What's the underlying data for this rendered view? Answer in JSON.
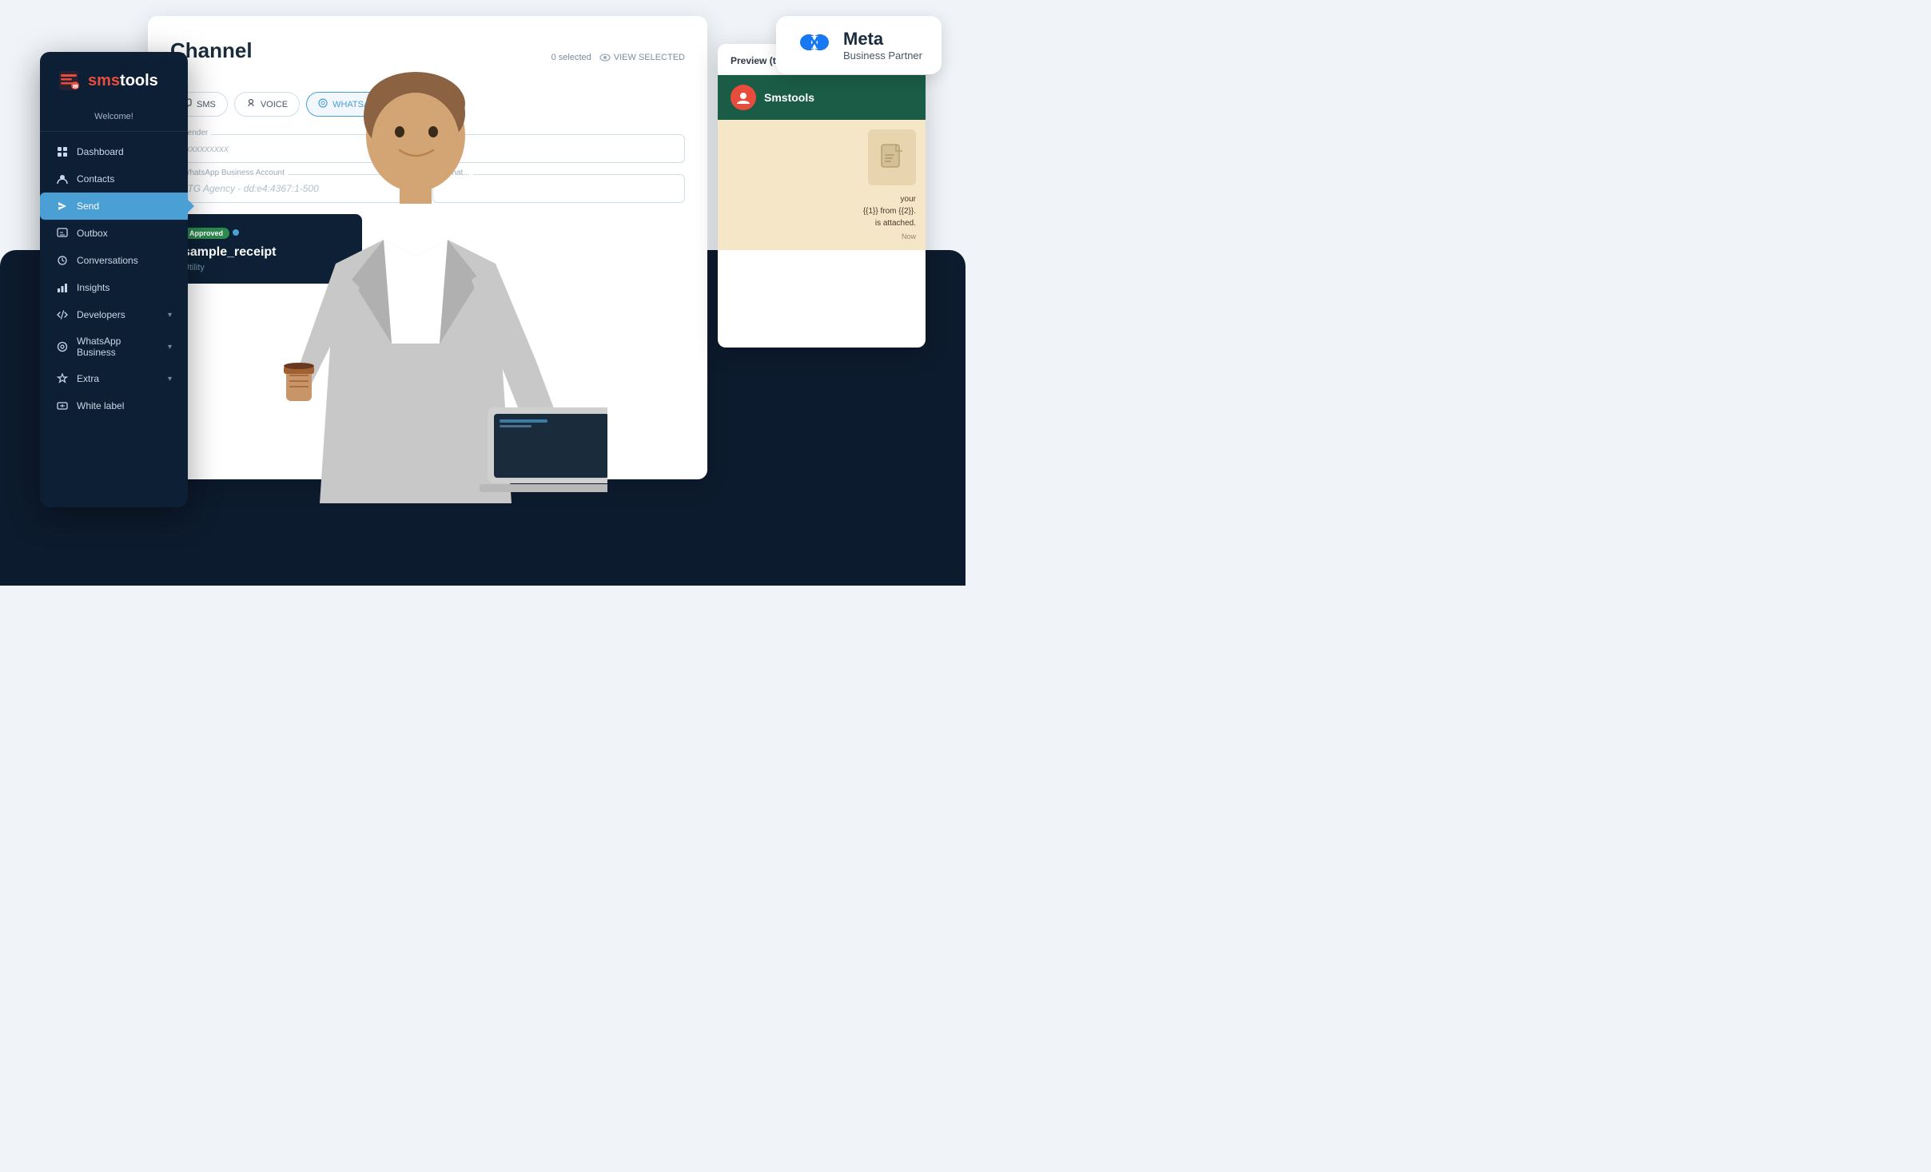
{
  "sidebar": {
    "logo": {
      "sms": "sms",
      "tools": "tools"
    },
    "welcome": "Welcome!",
    "items": [
      {
        "id": "dashboard",
        "label": "Dashboard",
        "icon": "⊞",
        "active": false,
        "hasChevron": false
      },
      {
        "id": "contacts",
        "label": "Contacts",
        "icon": "👤",
        "active": false,
        "hasChevron": false
      },
      {
        "id": "send",
        "label": "Send",
        "icon": "➤",
        "active": true,
        "hasChevron": false
      },
      {
        "id": "outbox",
        "label": "Outbox",
        "icon": "⬜",
        "active": false,
        "hasChevron": false
      },
      {
        "id": "conversations",
        "label": "Conversations",
        "icon": "🕐",
        "active": false,
        "hasChevron": false
      },
      {
        "id": "insights",
        "label": "Insights",
        "icon": "📊",
        "active": false,
        "hasChevron": false
      },
      {
        "id": "developers",
        "label": "Developers",
        "icon": "</>",
        "active": false,
        "hasChevron": true
      },
      {
        "id": "whatsapp",
        "label": "WhatsApp Business",
        "icon": "◎",
        "active": false,
        "hasChevron": true
      },
      {
        "id": "extra",
        "label": "Extra",
        "icon": "⬡",
        "active": false,
        "hasChevron": true
      },
      {
        "id": "whitelabel",
        "label": "White label",
        "icon": "🏷",
        "active": false,
        "hasChevron": false
      }
    ]
  },
  "channel": {
    "title": "Channel",
    "tabs": [
      {
        "id": "sms",
        "label": "SMS",
        "icon": "📱",
        "active": false
      },
      {
        "id": "voice",
        "label": "VOICE",
        "icon": "🎙",
        "active": false
      },
      {
        "id": "whatsapp",
        "label": "WHATSAPP BUSINESS",
        "icon": "💬",
        "active": true
      }
    ],
    "selected_count": "0 selected",
    "view_selected": "VIEW SELECTED",
    "sender_label": "Sender",
    "sender_value": "xxxxxxxxxx",
    "account_label": "WhatsApp Business Account",
    "account_value": "RTG Agency - dd:e4:4367:1-500",
    "template_section": {
      "approved_label": "Approved",
      "name": "sample_receipt",
      "type": "Utility"
    }
  },
  "preview": {
    "header": "Preview (this is a preview only)",
    "brand_name": "Smstools",
    "text_line1": "your",
    "text_line2": "{{1}} from {{2}}.",
    "text_line3": "is attached.",
    "timestamp": "Now"
  },
  "meta": {
    "title": "Meta",
    "subtitle": "Business Partner"
  }
}
